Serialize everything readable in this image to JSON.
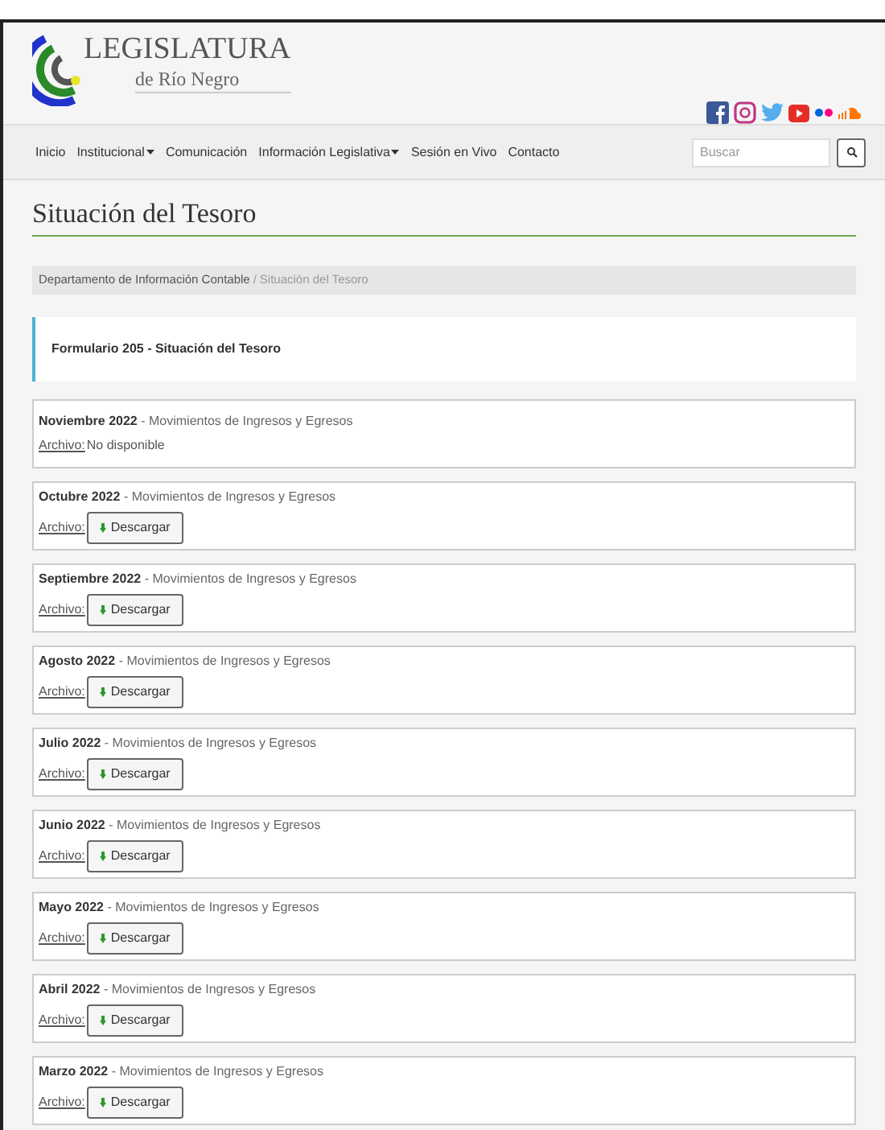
{
  "logo": {
    "title": "LEGISLATURA",
    "subtitle": "de Río Negro"
  },
  "nav": [
    {
      "label": "Inicio",
      "dropdown": false
    },
    {
      "label": "Institucional",
      "dropdown": true
    },
    {
      "label": "Comunicación",
      "dropdown": false
    },
    {
      "label": "Información Legislativa",
      "dropdown": true
    },
    {
      "label": "Sesión en Vivo",
      "dropdown": false
    },
    {
      "label": "Contacto",
      "dropdown": false
    }
  ],
  "search": {
    "placeholder": "Buscar"
  },
  "page_title": "Situación del Tesoro",
  "breadcrumb_separator": "/",
  "breadcrumb": [
    {
      "label": "Departamento de Información Contable",
      "current": false
    },
    {
      "label": "Situación del Tesoro",
      "current": true
    }
  ],
  "form_title": "Formulario 205 - Situación del Tesoro",
  "entries": [
    {
      "period": "Noviembre 2022",
      "description": "- Movimientos de Ingresos y Egresos",
      "file_label": "Archivo:",
      "kind": "unavailable",
      "status": "No disponible"
    },
    {
      "period": "Octubre 2022",
      "description": "- Movimientos de Ingresos y Egresos",
      "file_label": "Archivo:",
      "kind": "download",
      "button": "Descargar"
    },
    {
      "period": "Septiembre 2022",
      "description": "- Movimientos de Ingresos y Egresos",
      "file_label": "Archivo:",
      "kind": "download",
      "button": "Descargar"
    },
    {
      "period": "Agosto 2022",
      "description": "- Movimientos de Ingresos y Egresos",
      "file_label": "Archivo:",
      "kind": "download",
      "button": "Descargar"
    },
    {
      "period": "Julio 2022",
      "description": "- Movimientos de Ingresos y Egresos",
      "file_label": "Archivo:",
      "kind": "download",
      "button": "Descargar"
    },
    {
      "period": "Junio 2022",
      "description": "- Movimientos de Ingresos y Egresos",
      "file_label": "Archivo:",
      "kind": "download",
      "button": "Descargar"
    },
    {
      "period": "Mayo 2022",
      "description": "- Movimientos de Ingresos y Egresos",
      "file_label": "Archivo:",
      "kind": "download",
      "button": "Descargar"
    },
    {
      "period": "Abril 2022",
      "description": "- Movimientos de Ingresos y Egresos",
      "file_label": "Archivo:",
      "kind": "download",
      "button": "Descargar"
    },
    {
      "period": "Marzo 2022",
      "description": "- Movimientos de Ingresos y Egresos",
      "file_label": "Archivo:",
      "kind": "download",
      "button": "Descargar"
    }
  ]
}
